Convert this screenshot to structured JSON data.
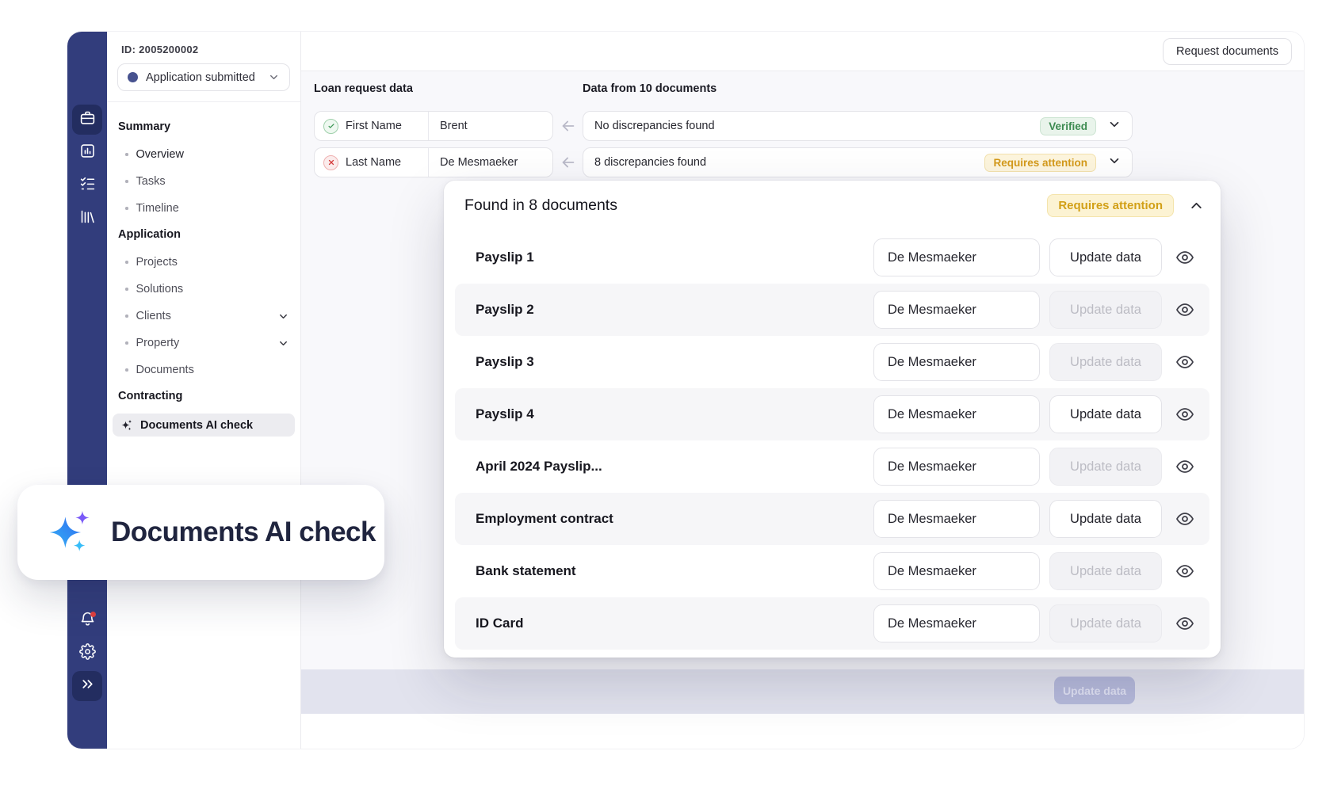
{
  "colors": {
    "rail_bg": "#323d7c",
    "rail_active_bg": "#232d60",
    "verified_green": "#3d8b51",
    "attention_amber": "#d49a1b",
    "notification_red": "#e03f3f",
    "sparkle_blue": "#2f7df6",
    "sparkle_purple": "#7a5af8",
    "sparkle_cyan": "#38bdf8"
  },
  "sidebar": {
    "id_label": "ID: 2005200002",
    "status_select": "Application submitted",
    "section_summary": "Summary",
    "section_application": "Application",
    "section_contracting": "Contracting",
    "overview": "Overview",
    "tasks": "Tasks",
    "timeline": "Timeline",
    "projects": "Projects",
    "solutions": "Solutions",
    "clients": "Clients",
    "property": "Property",
    "documents": "Documents",
    "ai_check": "Documents AI check"
  },
  "topbar": {
    "request_documents": "Request documents"
  },
  "comparison": {
    "left_title": "Loan request data",
    "right_title": "Data from 10 documents",
    "rows": [
      {
        "status": "verified",
        "field": "First Name",
        "value": "Brent",
        "result": "No discrepancies found",
        "badge": "Verified"
      },
      {
        "status": "attention",
        "field": "Last Name",
        "value": "De Mesmaeker",
        "result": "8 discrepancies found",
        "badge": "Requires attention"
      }
    ]
  },
  "popup": {
    "title": "Found in 8 documents",
    "badge": "Requires attention",
    "rows": [
      {
        "label": "Payslip 1",
        "value": "De Mesmaeker",
        "button": "Update data",
        "enabled": true
      },
      {
        "label": "Payslip 2",
        "value": "De Mesmaeker",
        "button": "Update data",
        "enabled": false
      },
      {
        "label": "Payslip 3",
        "value": "De Mesmaeker",
        "button": "Update data",
        "enabled": false
      },
      {
        "label": "Payslip 4",
        "value": "De Mesmaeker",
        "button": "Update data",
        "enabled": true
      },
      {
        "label": "April 2024 Payslip...",
        "value": "De Mesmaeker",
        "button": "Update data",
        "enabled": false
      },
      {
        "label": "Employment contract",
        "value": "De Mesmaeker",
        "button": "Update data",
        "enabled": true
      },
      {
        "label": "Bank statement",
        "value": "De Mesmaeker",
        "button": "Update data",
        "enabled": false
      },
      {
        "label": "ID Card",
        "value": "De Mesmaeker",
        "button": "Update data",
        "enabled": false
      }
    ]
  },
  "footer": {
    "update_button": "Update data"
  },
  "overlay": {
    "title": "Documents AI check"
  }
}
